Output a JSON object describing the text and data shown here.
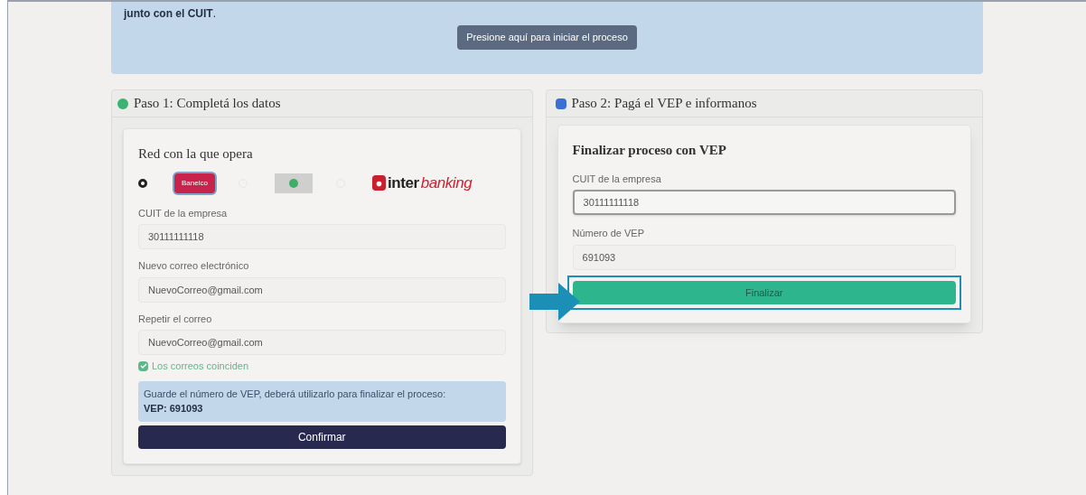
{
  "banner": {
    "text": "**junto con el CUIT**.",
    "button": "Presione aquí para iniciar el proceso"
  },
  "step1": {
    "title": "Paso 1: Completá los datos",
    "card_title": "Red con la que opera",
    "networks": [
      {
        "kind": "banelco",
        "logo_text": "Banelco",
        "selected": true
      },
      {
        "kind": "link",
        "selected": false
      },
      {
        "kind": "interbanking",
        "logo_text": "inter",
        "logo_text_2": "banking",
        "selected": false
      }
    ],
    "fields": [
      {
        "label": "CUIT de la empresa",
        "value": "30111111118"
      },
      {
        "label": "Nuevo correo electrónico",
        "value": "NuevoCorreo@gmail.com"
      },
      {
        "label": "Repetir el correo",
        "value": "NuevoCorreo@gmail.com"
      }
    ],
    "match": {
      "checked": true,
      "label": "Los correos coinciden"
    },
    "notice": {
      "text": "Guarde el número de VEP, deberá utilizarlo para finalizar el proceso:",
      "vep": "VEP: 691093"
    },
    "button": "Confirmar"
  },
  "step2": {
    "title": "Paso 2: Pagá el VEP e informanos",
    "card_title": "Finalizar proceso con VEP",
    "fields": [
      {
        "label": "CUIT de la empresa",
        "value": "30111111118",
        "focused": true
      },
      {
        "label": "Número de VEP",
        "value": "691093",
        "focused": false
      }
    ],
    "button": "Finalizar",
    "highlighted": true
  }
}
